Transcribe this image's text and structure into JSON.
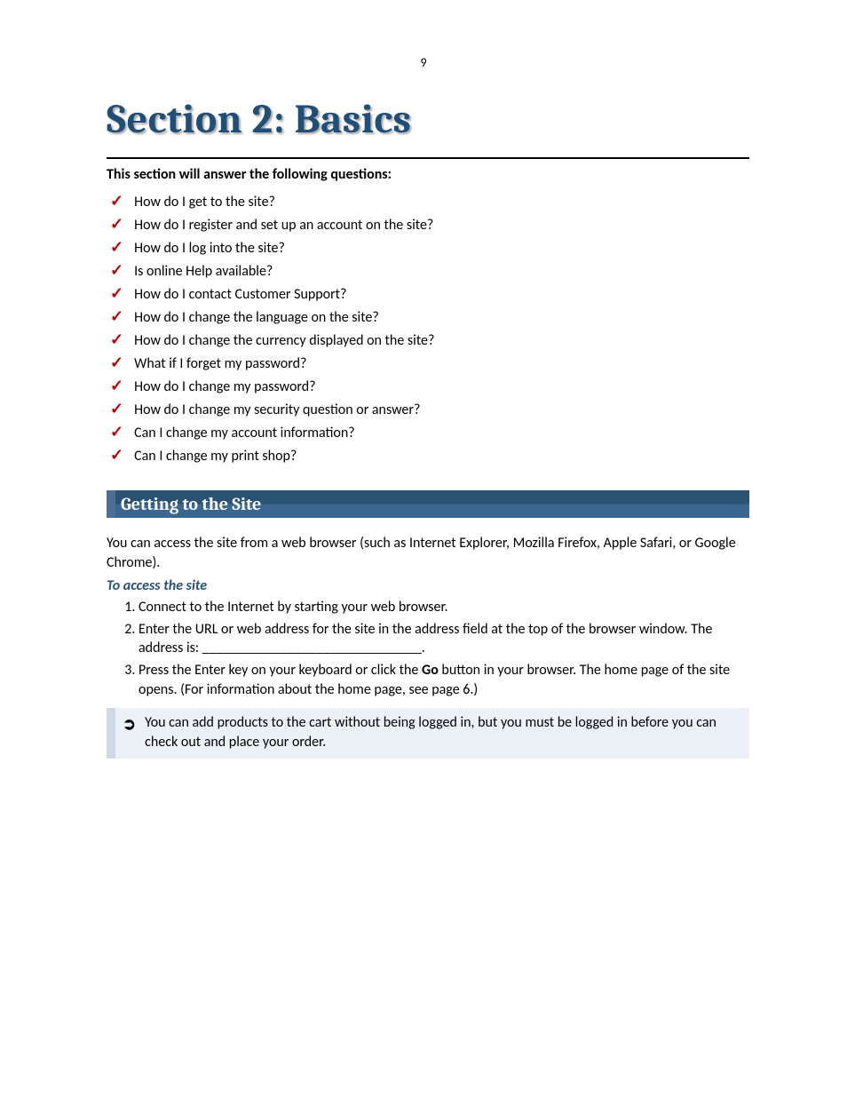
{
  "page_number": "9",
  "title": "Section 2: Basics",
  "intro": "This section will answer the following questions:",
  "questions": [
    "How do I get to the site?",
    "How do I register and set up an account on the site?",
    "How do I log into the site?",
    "Is online Help available?",
    "How do I contact Customer Support?",
    "How do I change the language on the site?",
    "How do I change the currency displayed on the site?",
    "What if I forget my password?",
    "How do I change my password?",
    "How do I change my security question or answer?",
    "Can I change my account information?",
    "Can I change my print shop?"
  ],
  "subheader": "Getting to the Site",
  "access_para": "You can access the site from a web browser (such as Internet Explorer, Mozilla Firefox, Apple Safari, or Google Chrome).",
  "access_heading": "To access the site",
  "steps": {
    "s1": "Connect to the Internet by starting your web browser.",
    "s2": "Enter the URL or web address for the site in the address field at the top of the browser window. The address is: _______________________________.",
    "s3_before": "Press the Enter key on your keyboard or click the ",
    "s3_bold": "Go",
    "s3_after": " button in your browser. The home page of the site opens. (For information about the home page, see page 6.)"
  },
  "note": "You can add products to the cart without being logged in, but you must be logged in before you can check out and place your order.",
  "icons": {
    "check": "✓",
    "arrow": "➲"
  }
}
